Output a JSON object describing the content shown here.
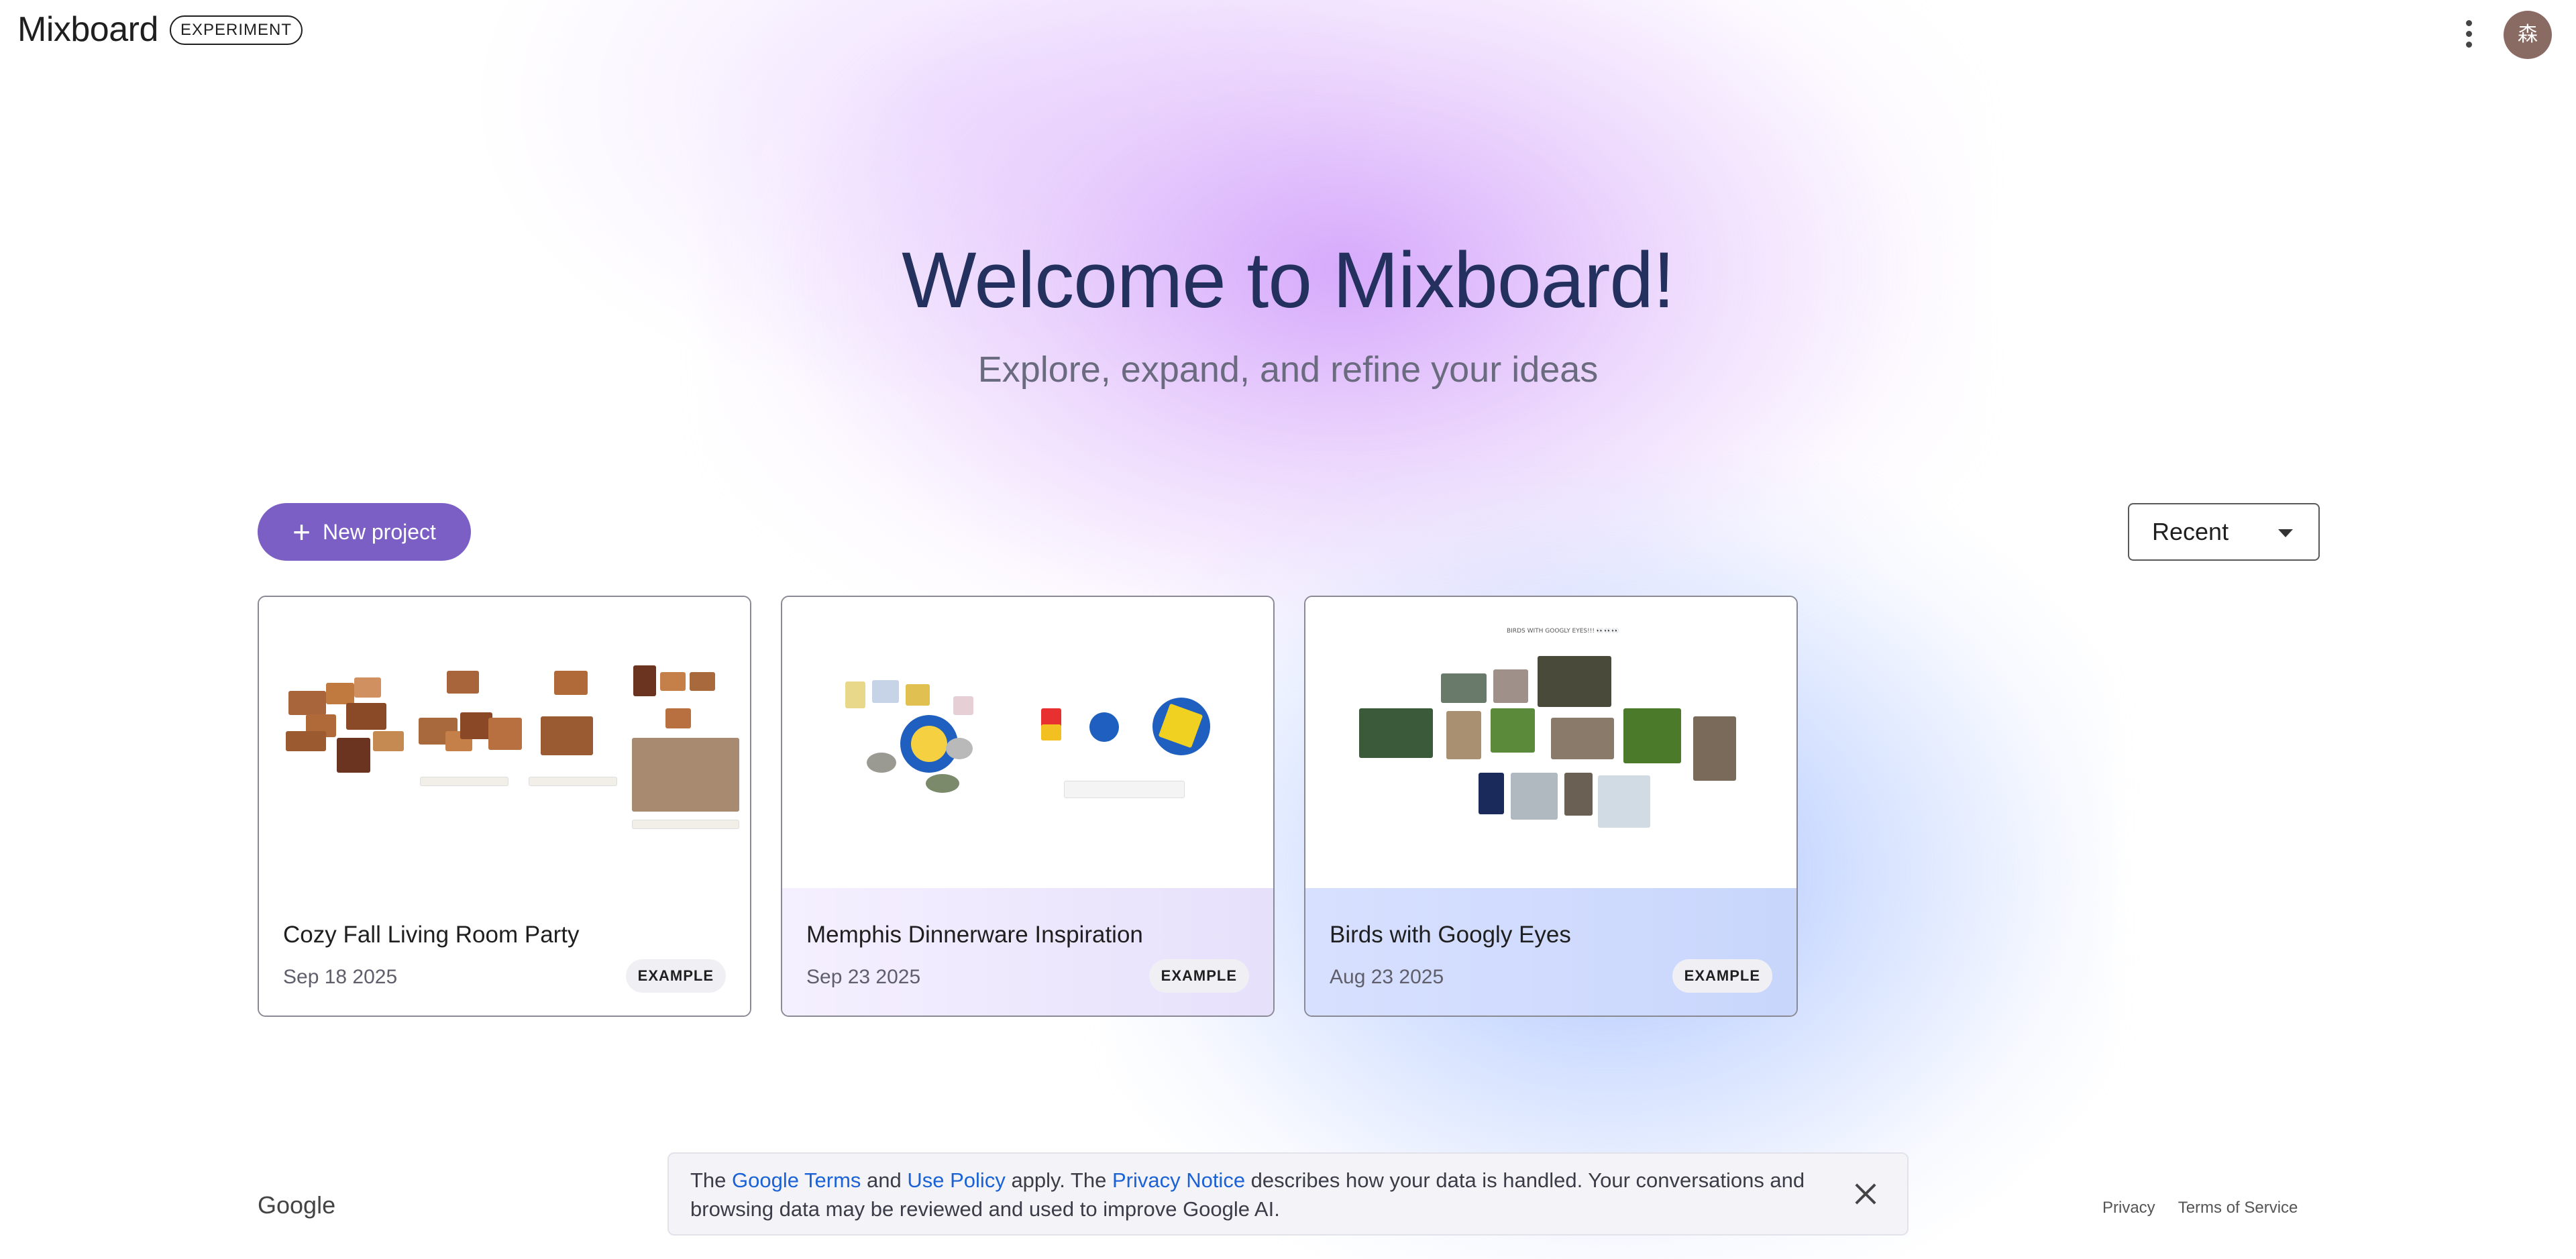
{
  "app": {
    "name": "Mixboard",
    "badge": "EXPERIMENT",
    "avatar_initial": "森"
  },
  "hero": {
    "title": "Welcome to Mixboard!",
    "subtitle": "Explore, expand, and refine your ideas"
  },
  "toolbar": {
    "new_project_label": "New project",
    "sort_value": "Recent"
  },
  "projects": [
    {
      "title": "Cozy Fall Living Room Party",
      "date": "Sep 18 2025",
      "tag": "EXAMPLE"
    },
    {
      "title": "Memphis Dinnerware Inspiration",
      "date": "Sep 23 2025",
      "tag": "EXAMPLE"
    },
    {
      "title": "Birds with Googly Eyes",
      "date": "Aug 23 2025",
      "tag": "EXAMPLE"
    }
  ],
  "thumb_labels": {
    "card3_heading": "BIRDS WITH GOOGLY EYES!!! 👀👀👀"
  },
  "footer": {
    "brand": "Google",
    "notice_prefix": "The ",
    "link_terms": "Google Terms",
    "notice_and": " and ",
    "link_use": "Use Policy",
    "notice_mid": " apply. The ",
    "link_privacy": "Privacy Notice",
    "notice_suffix": " describes how your data is handled. Your conversations and browsing data may be reviewed and used to improve Google AI.",
    "privacy_label": "Privacy",
    "tos_label": "Terms of Service"
  },
  "colors": {
    "primary": "#7c5fc4",
    "title": "#24305e",
    "link": "#1a62d6"
  }
}
